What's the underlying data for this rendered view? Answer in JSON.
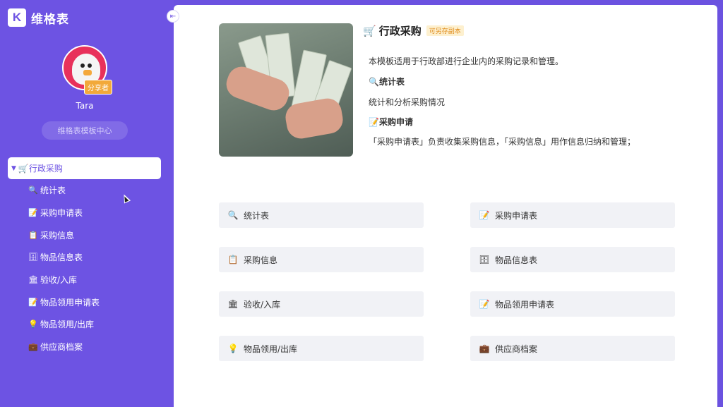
{
  "app": {
    "logo_mark": "K",
    "name": "维格表"
  },
  "profile": {
    "username": "Tara",
    "badge": "分享者",
    "template_center": "维格表模板中心"
  },
  "sidebar": {
    "root": {
      "caret": "▼",
      "icon": "🛒",
      "label": "行政采购"
    },
    "items": [
      {
        "icon": "🔍",
        "icon_name": "magnifier-icon",
        "label": "统计表"
      },
      {
        "icon": "📝",
        "icon_name": "memo-icon",
        "label": "采购申请表"
      },
      {
        "icon": "📋",
        "icon_name": "clipboard-icon",
        "label": "采购信息"
      },
      {
        "icon": "🗄",
        "icon_name": "cabinet-icon",
        "label": "物品信息表"
      },
      {
        "icon": "🏛",
        "icon_name": "bank-icon",
        "label": "验收/入库"
      },
      {
        "icon": "📝",
        "icon_name": "memo-icon",
        "label": "物品领用申请表"
      },
      {
        "icon": "💡",
        "icon_name": "bulb-icon",
        "label": "物品领用/出库"
      },
      {
        "icon": "💼",
        "icon_name": "briefcase-icon",
        "label": "供应商档案"
      }
    ]
  },
  "main": {
    "title_icon": "🛒",
    "title": "行政采购",
    "copy_tag": "可另存副本",
    "desc_1": "本模板适用于行政部进行企业内的采购记录和管理。",
    "section_1_title": "🔍统计表",
    "section_1_text": "统计和分析采购情况",
    "section_2_title": "📝采购申请",
    "section_2_text": "「采购申请表」负责收集采购信息，「采购信息」用作信息归纳和管理；",
    "cards": [
      {
        "icon": "🔍",
        "icon_name": "magnifier-icon",
        "label": "统计表"
      },
      {
        "icon": "📝",
        "icon_name": "memo-icon",
        "label": "采购申请表"
      },
      {
        "icon": "📋",
        "icon_name": "clipboard-icon",
        "label": "采购信息"
      },
      {
        "icon": "🗄",
        "icon_name": "cabinet-icon",
        "label": "物品信息表"
      },
      {
        "icon": "🏛",
        "icon_name": "bank-icon",
        "label": "验收/入库"
      },
      {
        "icon": "📝",
        "icon_name": "memo-icon",
        "label": "物品领用申请表"
      },
      {
        "icon": "💡",
        "icon_name": "bulb-icon",
        "label": "物品领用/出库"
      },
      {
        "icon": "💼",
        "icon_name": "briefcase-icon",
        "label": "供应商档案"
      }
    ]
  },
  "colors": {
    "brand": "#6d53e3",
    "card_bg": "#f1f2f6",
    "copy_tag_text": "#e08b1b"
  }
}
